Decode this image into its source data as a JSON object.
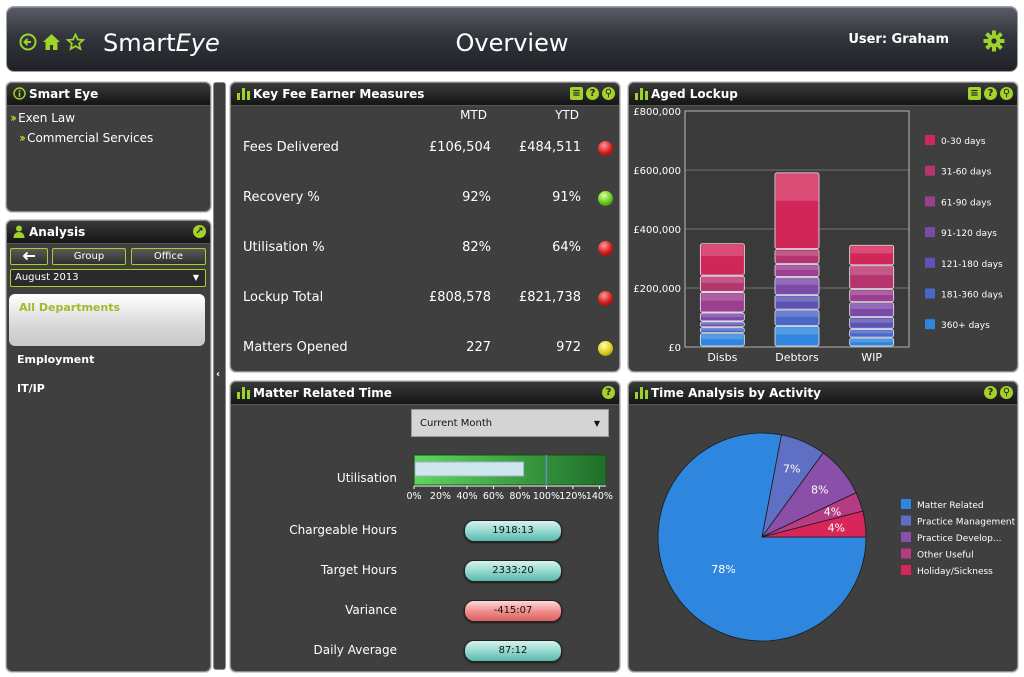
{
  "header": {
    "brand_main": "Smart",
    "brand_italic": "Eye",
    "title": "Overview",
    "user": "User: Graham"
  },
  "colors": {
    "accent": "#9cd22a",
    "panel_bg": "#3f3f3f"
  },
  "smart_eye": {
    "title": "Smart Eye",
    "items": [
      {
        "label": "Exen Law"
      },
      {
        "label": "Commercial Services"
      }
    ]
  },
  "analysis": {
    "title": "Analysis",
    "back_icon": "arrow-left-icon",
    "group_label": "Group",
    "office_label": "Office",
    "period_selected": "August 2013",
    "departments": [
      {
        "label": "All Departments"
      },
      {
        "label": "Employment"
      },
      {
        "label": "IT/IP"
      }
    ]
  },
  "kfem": {
    "title": "Key Fee Earner Measures",
    "col_mtd": "MTD",
    "col_ytd": "YTD",
    "rows": [
      {
        "label": "Fees Delivered",
        "mtd": "£106,504",
        "ytd": "£484,511",
        "status": "red"
      },
      {
        "label": "Recovery %",
        "mtd": "92%",
        "ytd": "91%",
        "status": "green"
      },
      {
        "label": "Utilisation %",
        "mtd": "82%",
        "ytd": "64%",
        "status": "red"
      },
      {
        "label": "Lockup Total",
        "mtd": "£808,578",
        "ytd": "£821,738",
        "status": "red"
      },
      {
        "label": "Matters Opened",
        "mtd": "227",
        "ytd": "972",
        "status": "yellow"
      }
    ]
  },
  "matter_time": {
    "title": "Matter Related Time",
    "period_selected": "Current Month",
    "utilisation_label": "Utilisation",
    "utilisation_ticks": [
      "0%",
      "20%",
      "40%",
      "60%",
      "80%",
      "100%",
      "120%",
      "140%"
    ],
    "utilisation_value": 82,
    "utilisation_target": 100,
    "rows": [
      {
        "label": "Chargeable Hours",
        "value": "1918:13",
        "tone": "teal"
      },
      {
        "label": "Target Hours",
        "value": "2333:20",
        "tone": "teal"
      },
      {
        "label": "Variance",
        "value": "-415:07",
        "tone": "red"
      },
      {
        "label": "Daily Average",
        "value": "87:12",
        "tone": "teal"
      }
    ]
  },
  "aged_lockup": {
    "title": "Aged Lockup",
    "chart_data": {
      "type": "bar",
      "stacked": true,
      "categories": [
        "Disbs",
        "Debtors",
        "WIP"
      ],
      "y_ticks": [
        "£0",
        "£200,000",
        "£400,000",
        "£600,000",
        "£800,000"
      ],
      "ylim": [
        0,
        800000
      ],
      "grid": true,
      "legend_position": "right",
      "series": [
        {
          "name": "360+ days",
          "color": "#2e86de",
          "values": [
            45000,
            70000,
            30000
          ]
        },
        {
          "name": "181-360 days",
          "color": "#4a66c8",
          "values": [
            20000,
            55000,
            30000
          ]
        },
        {
          "name": "121-180 days",
          "color": "#5d53b6",
          "values": [
            20000,
            50000,
            40000
          ]
        },
        {
          "name": "91-120 days",
          "color": "#7b4aa8",
          "values": [
            30000,
            60000,
            50000
          ]
        },
        {
          "name": "61-90 days",
          "color": "#9c3f90",
          "values": [
            70000,
            45000,
            45000
          ]
        },
        {
          "name": "31-60 days",
          "color": "#b5356f",
          "values": [
            55000,
            50000,
            80000
          ]
        },
        {
          "name": "0-30 days",
          "color": "#d1265a",
          "values": [
            110000,
            260000,
            70000
          ]
        }
      ]
    }
  },
  "time_analysis": {
    "title": "Time Analysis by Activity",
    "chart_data": {
      "type": "pie",
      "legend_position": "right",
      "slices": [
        {
          "name": "Matter Related",
          "value": 78,
          "label": "78%",
          "color": "#2e86de"
        },
        {
          "name": "Practice Management",
          "value": 7,
          "label": "7%",
          "color": "#5f6fc4"
        },
        {
          "name": "Practice Develop...",
          "value": 8,
          "label": "8%",
          "color": "#8a4fa8"
        },
        {
          "name": "Other Useful",
          "value": 3,
          "label": "4%",
          "color": "#b53b83"
        },
        {
          "name": "Holiday/Sickness",
          "value": 4,
          "label": "4%",
          "color": "#d8265a"
        }
      ]
    }
  }
}
